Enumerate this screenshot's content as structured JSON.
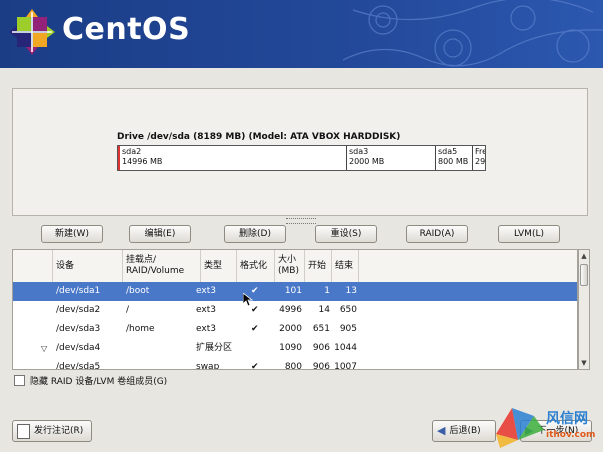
{
  "brand": {
    "name": "CentOS"
  },
  "drive": {
    "title": "Drive /dev/sda (8189 MB) (Model: ATA VBOX HARDDISK)",
    "segments": [
      {
        "name": "sda2",
        "size": "14996 MB"
      },
      {
        "name": "sda3",
        "size": "2000 MB"
      },
      {
        "name": "sda5",
        "size": "800 MB"
      },
      {
        "name": "Fre",
        "size": "29"
      }
    ]
  },
  "actions": {
    "new": "新建(W)",
    "edit": "编辑(E)",
    "delete": "删除(D)",
    "reset": "重设(S)",
    "raid": "RAID(A)",
    "lvm": "LVM(L)"
  },
  "table": {
    "headers": {
      "device": "设备",
      "mount": "挂载点/\nRAID/Volume",
      "type": "类型",
      "format": "格式化",
      "size": "大小\n(MB)",
      "start": "开始",
      "end": "结束"
    },
    "rows": [
      {
        "device": "/dev/sda1",
        "mount": "/boot",
        "type": "ext3",
        "format": "✔",
        "size": "101",
        "start": "1",
        "end": "13"
      },
      {
        "device": "/dev/sda2",
        "mount": "/",
        "type": "ext3",
        "format": "✔",
        "size": "4996",
        "start": "14",
        "end": "650"
      },
      {
        "device": "/dev/sda3",
        "mount": "/home",
        "type": "ext3",
        "format": "✔",
        "size": "2000",
        "start": "651",
        "end": "905"
      },
      {
        "device": "/dev/sda4",
        "mount": "",
        "type": "扩展分区",
        "format": "",
        "size": "1090",
        "start": "906",
        "end": "1044"
      },
      {
        "device": "/dev/sda5",
        "mount": "",
        "type": "swap",
        "format": "✔",
        "size": "800",
        "start": "906",
        "end": "1007"
      }
    ]
  },
  "hide_raid_label": "隐藏 RAID 设备/LVM 卷组成员(G)",
  "bottom": {
    "release_notes": "发行注记(R)",
    "back": "后退(B)",
    "next": "下一步(N)"
  },
  "watermark": {
    "text": "风信网",
    "url": "ithov.com"
  },
  "colors": {
    "banner": "#23499a",
    "selection": "#4a78c8"
  }
}
